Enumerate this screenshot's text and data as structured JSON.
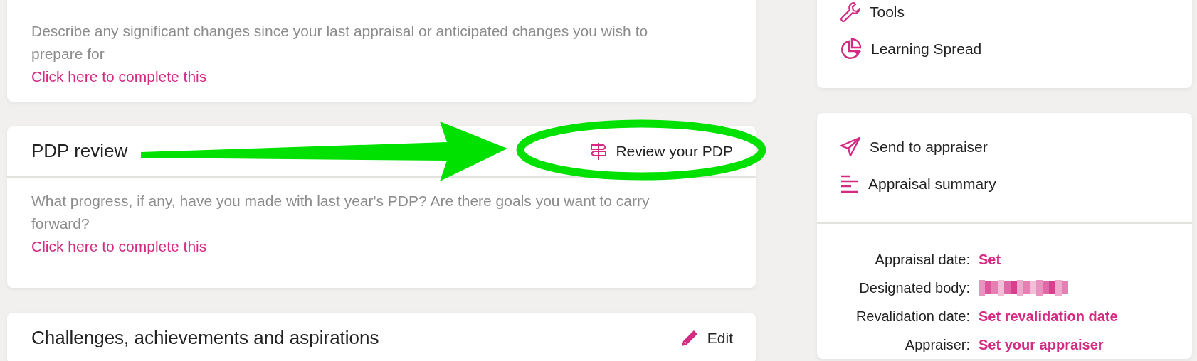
{
  "main_cards": [
    {
      "prompt": "Describe any significant changes since your last appraisal or anticipated changes you wish to prepare for",
      "link": "Click here to complete this"
    },
    {
      "title": "PDP review",
      "action": {
        "label": "Review your PDP"
      },
      "prompt": "What progress, if any, have you made with last year's PDP? Are there goals you want to carry forward?",
      "link": "Click here to complete this"
    },
    {
      "title": "Challenges, achievements and aspirations",
      "action": {
        "label": "Edit"
      }
    }
  ],
  "side_links_top": [
    {
      "label": "Tools"
    },
    {
      "label": "Learning Spread"
    }
  ],
  "side_links": [
    {
      "label": "Send to appraiser"
    },
    {
      "label": "Appraisal summary"
    }
  ],
  "details": [
    {
      "label": "Appraisal date:",
      "kind": "link",
      "value": "Set"
    },
    {
      "label": "Designated body:",
      "kind": "redacted"
    },
    {
      "label": "Revalidation date:",
      "kind": "link",
      "value": "Set revalidation date"
    },
    {
      "label": "Appraiser:",
      "kind": "link",
      "value": "Set your appraiser"
    }
  ],
  "annotation": {
    "arrow": true,
    "ring": true
  }
}
